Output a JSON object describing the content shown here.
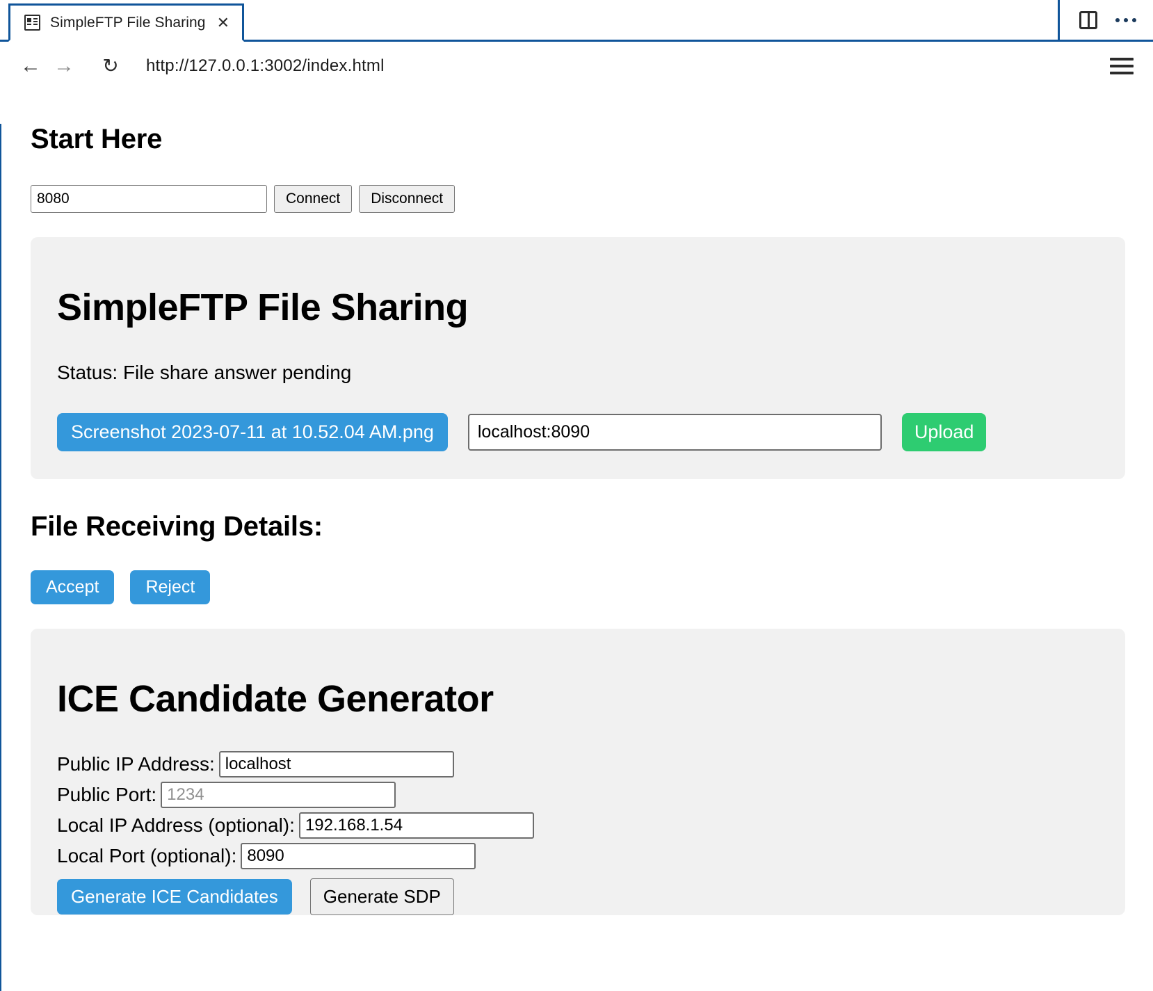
{
  "browser": {
    "tab": {
      "title": "SimpleFTP File Sharing",
      "close_label": "✕",
      "favicon_name": "page-layout-icon"
    },
    "toolbar": {
      "back_label": "←",
      "forward_label": "→",
      "reload_label": "↻",
      "url": "http://127.0.0.1:3002/index.html",
      "menu_label": "menu"
    },
    "window_controls": {
      "split_view_label": "split-view",
      "more_label": "more-options"
    }
  },
  "page": {
    "start_heading": "Start Here",
    "connect": {
      "port_value": "8080",
      "connect_label": "Connect",
      "disconnect_label": "Disconnect"
    },
    "share_card": {
      "title": "SimpleFTP File Sharing",
      "status": "Status: File share answer pending",
      "file_name": "Screenshot 2023-07-11 at 10.52.04 AM.png",
      "upload_target_value": "localhost:8090",
      "upload_label": "Upload"
    },
    "receiving": {
      "heading": "File Receiving Details:",
      "accept_label": "Accept",
      "reject_label": "Reject"
    },
    "ice": {
      "title": "ICE Candidate Generator",
      "fields": [
        {
          "label": "Public IP Address:",
          "value": "localhost",
          "placeholder": ""
        },
        {
          "label": "Public Port:",
          "value": "",
          "placeholder": "1234"
        },
        {
          "label": "Local IP Address (optional):",
          "value": "192.168.1.54",
          "placeholder": ""
        },
        {
          "label": "Local Port (optional):",
          "value": "8090",
          "placeholder": ""
        }
      ],
      "generate_ice_label": "Generate ICE Candidates",
      "generate_sdp_label": "Generate SDP"
    }
  },
  "colors": {
    "accent_blue": "#3498db",
    "chrome_blue": "#10559a",
    "upload_green": "#2ecc71",
    "card_gray": "#f1f1f1"
  }
}
